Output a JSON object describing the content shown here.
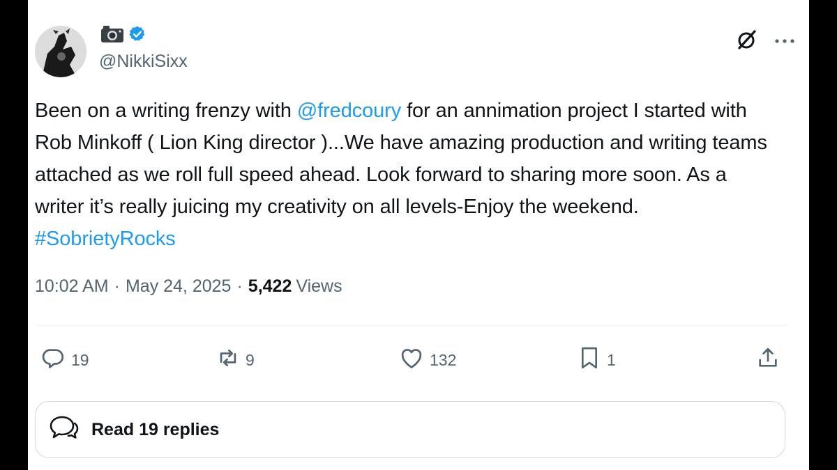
{
  "author": {
    "display_name_icon": "camera-icon",
    "verified_icon": "verified-badge-icon",
    "handle": "@NikkiSixx"
  },
  "top_actions": {
    "grok_icon": "grok-icon",
    "more_icon": "more-options-icon"
  },
  "tweet": {
    "segments": [
      {
        "text": "Been on a writing frenzy with ",
        "type": "text"
      },
      {
        "text": "@fredcoury",
        "type": "mention"
      },
      {
        "text": " for an annimation project I started with Rob Minkoff ( Lion King director )...We have amazing production and writing teams attached as we roll full speed ahead. Look forward to sharing more soon. As a writer it’s really juicing my creativity on all levels-Enjoy the weekend.  ",
        "type": "text"
      },
      {
        "text": "#SobrietyRocks",
        "type": "hashtag"
      }
    ]
  },
  "meta": {
    "time": "10:02 AM",
    "date": "May 24, 2025",
    "separator": "·",
    "views_count": "5,422",
    "views_label": "Views"
  },
  "actions": {
    "reply_count": "19",
    "repost_count": "9",
    "like_count": "132",
    "bookmark_count": "1"
  },
  "read_replies": {
    "label": "Read 19 replies"
  },
  "colors": {
    "accent": "#1d9bf0",
    "text": "#0f1419",
    "secondary": "#536471",
    "border": "#cfd9de"
  }
}
